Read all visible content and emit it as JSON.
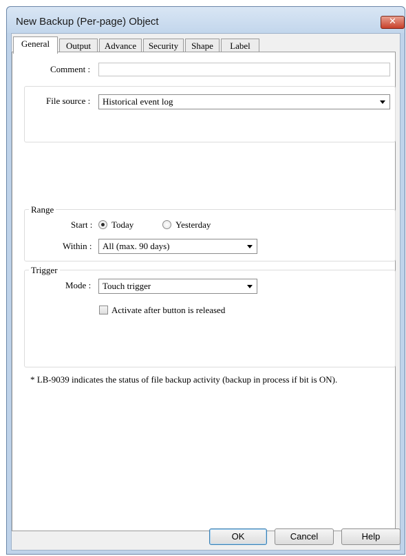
{
  "window": {
    "title": "New Backup (Per-page) Object",
    "close_glyph": "✕"
  },
  "tabs": [
    {
      "label": "General",
      "active": true
    },
    {
      "label": "Output"
    },
    {
      "label": "Advance"
    },
    {
      "label": "Security"
    },
    {
      "label": "Shape"
    },
    {
      "label": "Label"
    }
  ],
  "general": {
    "comment_label": "Comment :",
    "comment_value": "",
    "file_source_label": "File source :",
    "file_source_value": "Historical event log"
  },
  "range": {
    "title": "Range",
    "start_label": "Start :",
    "option_today": "Today",
    "option_yesterday": "Yesterday",
    "selected": "Today",
    "within_label": "Within :",
    "within_value": "All (max. 90 days)"
  },
  "trigger": {
    "title": "Trigger",
    "mode_label": "Mode :",
    "mode_value": "Touch trigger",
    "activate_label": "Activate after button is released",
    "activate_checked": false
  },
  "note": "* LB-9039 indicates the status of file backup activity (backup in process if bit is ON).",
  "buttons": {
    "ok": "OK",
    "cancel": "Cancel",
    "help": "Help"
  }
}
